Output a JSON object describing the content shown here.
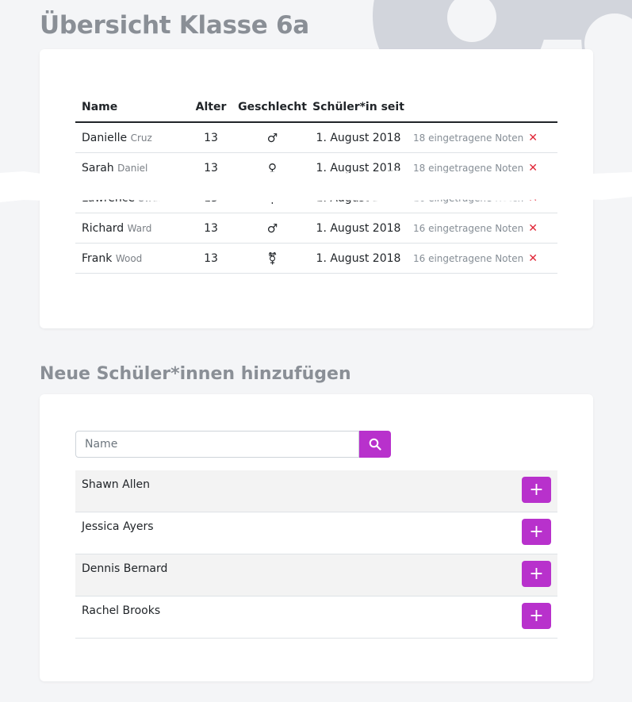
{
  "page_title": "Übersicht Klasse 6a",
  "students_table": {
    "headers": {
      "name": "Name",
      "age": "Alter",
      "gender": "Geschlecht",
      "since": "Schüler*in seit"
    },
    "rows": [
      {
        "first": "Danielle",
        "last": "Cruz",
        "age": "13",
        "gender": "♂",
        "since": "1. August 2018",
        "grades": "18 eingetragene Noten",
        "remove": "✕"
      },
      {
        "first": "Sarah",
        "last": "Daniel",
        "age": "13",
        "gender": "♀",
        "since": "1. August 2018",
        "grades": "18 eingetragene Noten",
        "remove": "✕"
      },
      {
        "first": "Lawrence",
        "last": "Swan",
        "age": "13",
        "gender": "⚲",
        "since": "1. August 2018",
        "grades": "16 eingetragene Noten",
        "remove": "✕"
      },
      {
        "first": "Richard",
        "last": "Ward",
        "age": "13",
        "gender": "♂",
        "since": "1. August 2018",
        "grades": "16 eingetragene Noten",
        "remove": "✕"
      },
      {
        "first": "Frank",
        "last": "Wood",
        "age": "13",
        "gender": "⚧",
        "since": "1. August 2018",
        "grades": "16 eingetragene Noten",
        "remove": "✕"
      }
    ]
  },
  "add_section": {
    "title": "Neue Schüler*innen hinzufügen",
    "search_placeholder": "Name",
    "candidates": [
      {
        "name": "Shawn Allen",
        "add": "+"
      },
      {
        "name": "Jessica Ayers",
        "add": "+"
      },
      {
        "name": "Dennis Bernard",
        "add": "+"
      },
      {
        "name": "Rachel Brooks",
        "add": "+"
      }
    ]
  },
  "colors": {
    "accent": "#b831cc",
    "remove": "#e02435",
    "heading": "#8a8f96",
    "background": "#f4f5f7"
  },
  "icons": {
    "search": "search-icon",
    "add": "plus-icon",
    "remove": "close-icon"
  }
}
